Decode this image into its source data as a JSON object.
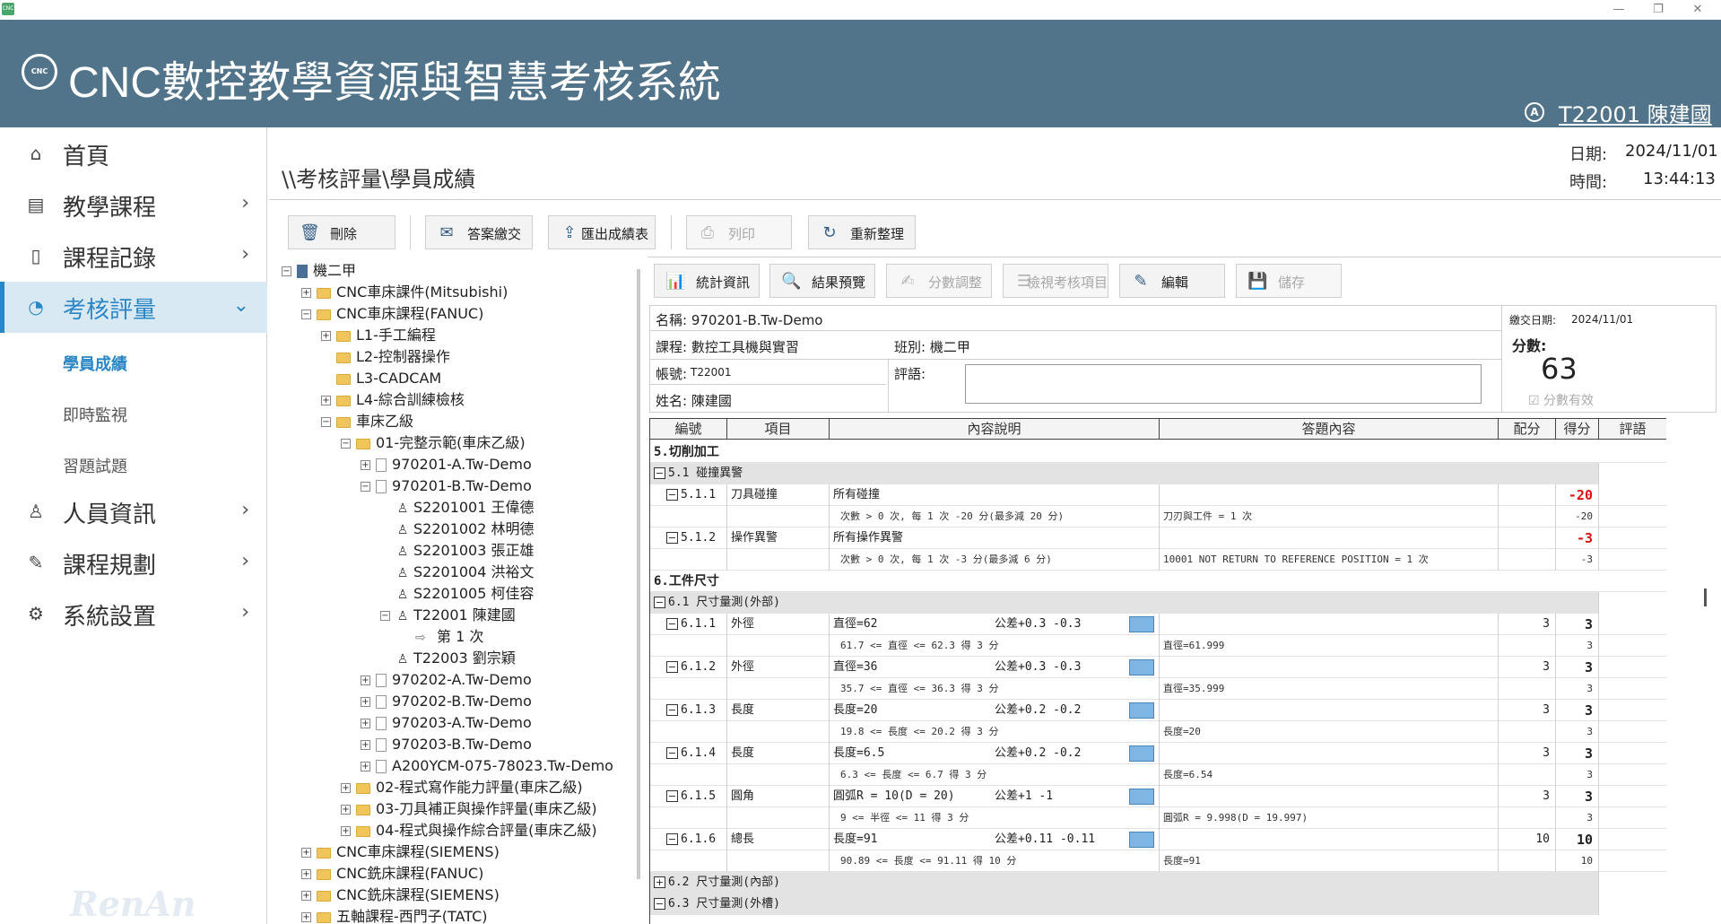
{
  "window": {
    "icon_text": "CNC",
    "minimize": "—",
    "maximize": "❐",
    "close": "✕"
  },
  "header": {
    "logo_text": "CNC",
    "title": "CNC數控教學資源與智慧考核系統",
    "user_icon": "A",
    "user": "T22001 陳建國"
  },
  "sidebar": {
    "items": [
      {
        "label": "首頁",
        "icon": "home-icon"
      },
      {
        "label": "教學課程",
        "icon": "cnc-icon"
      },
      {
        "label": "課程記錄",
        "icon": "document-icon"
      },
      {
        "label": "考核評量",
        "icon": "chart-icon"
      },
      {
        "label": "人員資訊",
        "icon": "person-icon"
      },
      {
        "label": "課程規劃",
        "icon": "pencil-icon"
      },
      {
        "label": "系統設置",
        "icon": "gear-icon"
      }
    ],
    "sub_items": [
      "學員成績",
      "即時監視",
      "習題試題"
    ],
    "watermark": "RenAn"
  },
  "content": {
    "breadcrumb": "\\\\考核評量\\學員成績",
    "date_label": "日期:",
    "date_value": "2024/11/01",
    "time_label": "時間:",
    "time_value": "13:44:13"
  },
  "toolbar1": [
    "刪除",
    "答案繳交",
    "匯出成績表",
    "列印",
    "重新整理"
  ],
  "toolbar2": [
    "統計資訊",
    "結果預覽",
    "分數調整",
    "檢視考核項目",
    "編輯",
    "儲存"
  ],
  "tree": [
    {
      "text": "機二甲",
      "kind": "root",
      "exp": "−"
    },
    {
      "text": "CNC車床課件(Mitsubishi)",
      "kind": "folder",
      "exp": "+"
    },
    {
      "text": "CNC車床課程(FANUC)",
      "kind": "folder",
      "exp": "−"
    },
    {
      "text": "L1-手工編程",
      "kind": "folder",
      "exp": "+"
    },
    {
      "text": "L2-控制器操作",
      "kind": "folder",
      "exp": ""
    },
    {
      "text": "L3-CADCAM",
      "kind": "folder",
      "exp": ""
    },
    {
      "text": "L4-綜合訓練檢核",
      "kind": "folder",
      "exp": "+"
    },
    {
      "text": "車床乙級",
      "kind": "folder",
      "exp": "−"
    },
    {
      "text": "01-完整示範(車床乙級)",
      "kind": "folder",
      "exp": "−"
    },
    {
      "text": "970201-A.Tw-Demo",
      "kind": "doc",
      "exp": "+"
    },
    {
      "text": "970201-B.Tw-Demo",
      "kind": "doc",
      "exp": "−"
    },
    {
      "text": "S2201001 王偉德",
      "kind": "person",
      "exp": ""
    },
    {
      "text": "S2201002 林明德",
      "kind": "person",
      "exp": ""
    },
    {
      "text": "S2201003 張正雄",
      "kind": "person",
      "exp": ""
    },
    {
      "text": "S2201004 洪裕文",
      "kind": "person",
      "exp": ""
    },
    {
      "text": "S2201005 柯佳容",
      "kind": "person",
      "exp": ""
    },
    {
      "text": "T22001 陳建國",
      "kind": "person",
      "exp": "−"
    },
    {
      "text": "第 1 次",
      "kind": "arrow",
      "exp": ""
    },
    {
      "text": "T22003 劉宗穎",
      "kind": "person",
      "exp": ""
    },
    {
      "text": "970202-A.Tw-Demo",
      "kind": "doc",
      "exp": "+"
    },
    {
      "text": "970202-B.Tw-Demo",
      "kind": "doc",
      "exp": "+"
    },
    {
      "text": "970203-A.Tw-Demo",
      "kind": "doc",
      "exp": "+"
    },
    {
      "text": "970203-B.Tw-Demo",
      "kind": "doc",
      "exp": "+"
    },
    {
      "text": "A200YCM-075-78023.Tw-Demo",
      "kind": "doc",
      "exp": "+"
    },
    {
      "text": "02-程式寫作能力評量(車床乙級)",
      "kind": "folder",
      "exp": "+"
    },
    {
      "text": "03-刀具補正與操作評量(車床乙級)",
      "kind": "folder",
      "exp": "+"
    },
    {
      "text": "04-程式與操作綜合評量(車床乙級)",
      "kind": "folder",
      "exp": "+"
    },
    {
      "text": "CNC車床課程(SIEMENS)",
      "kind": "folder",
      "exp": "+"
    },
    {
      "text": "CNC銑床課程(FANUC)",
      "kind": "folder",
      "exp": "+"
    },
    {
      "text": "CNC銑床課程(SIEMENS)",
      "kind": "folder",
      "exp": "+"
    },
    {
      "text": "五軸課程-西門子(TATC)",
      "kind": "folder",
      "exp": "+"
    }
  ],
  "info": {
    "name": "名稱: 970201-B.Tw-Demo",
    "submit_date_label": "繳交日期:",
    "submit_date": "2024/11/01",
    "course": "課程: 數控工具機與實習",
    "class": "班別: 機二甲",
    "account_label": "帳號:",
    "account": "T22001",
    "comment_label": "評語:",
    "student": "姓名: 陳建國",
    "score_label": "分數:",
    "score": "63",
    "score_valid": "☑ 分數有效"
  },
  "grid": {
    "headers": [
      "編號",
      "項目",
      "內容說明",
      "答題內容",
      "配分",
      "得分",
      "評語"
    ],
    "rows": [
      {
        "type": "sec",
        "text": "5.切削加工"
      },
      {
        "type": "subsec",
        "mk": "−",
        "text": "5.1 碰撞異警"
      },
      {
        "type": "item",
        "mk": "−",
        "no": "5.1.1",
        "item": "刀具碰撞",
        "desc": "所有碰撞",
        "tol": "",
        "ans": "",
        "pts": "",
        "got": "-20",
        "red": true
      },
      {
        "type": "sub",
        "desc": "次數 > 0 次, 每 1 次 -20 分(最多減 20 分)",
        "ans": "刀刃與工件 = 1 次",
        "got": "-20"
      },
      {
        "type": "item",
        "mk": "−",
        "no": "5.1.2",
        "item": "操作異警",
        "desc": "所有操作異警",
        "tol": "",
        "ans": "",
        "pts": "",
        "got": "-3",
        "red": true
      },
      {
        "type": "sub",
        "desc": "次數 > 0 次, 每 1 次 -3 分(最多減 6 分)",
        "ans": "10001 NOT RETURN TO REFERENCE POSITION = 1 次",
        "got": "-3"
      },
      {
        "type": "sec",
        "text": "6.工件尺寸"
      },
      {
        "type": "subsec",
        "mk": "−",
        "text": "6.1 尺寸量測(外部)"
      },
      {
        "type": "item",
        "mk": "−",
        "no": "6.1.1",
        "item": "外徑",
        "desc": "直徑=62",
        "tol": "公差+0.3    -0.3",
        "ans": "",
        "pts": "3",
        "got": "3",
        "icon": true
      },
      {
        "type": "sub",
        "desc": "61.7 <= 直徑 <= 62.3 得 3 分",
        "ans": "直徑=61.999",
        "got": "3"
      },
      {
        "type": "item",
        "mk": "−",
        "no": "6.1.2",
        "item": "外徑",
        "desc": "直徑=36",
        "tol": "公差+0.3    -0.3",
        "ans": "",
        "pts": "3",
        "got": "3",
        "icon": true
      },
      {
        "type": "sub",
        "desc": "35.7 <= 直徑 <= 36.3 得 3 分",
        "ans": "直徑=35.999",
        "got": "3"
      },
      {
        "type": "item",
        "mk": "−",
        "no": "6.1.3",
        "item": "長度",
        "desc": "長度=20",
        "tol": "公差+0.2    -0.2",
        "ans": "",
        "pts": "3",
        "got": "3",
        "icon": true
      },
      {
        "type": "sub",
        "desc": "19.8 <= 長度 <= 20.2 得 3 分",
        "ans": "長度=20",
        "got": "3"
      },
      {
        "type": "item",
        "mk": "−",
        "no": "6.1.4",
        "item": "長度",
        "desc": "長度=6.5",
        "tol": "公差+0.2    -0.2",
        "ans": "",
        "pts": "3",
        "got": "3",
        "icon": true
      },
      {
        "type": "sub",
        "desc": "6.3 <= 長度 <= 6.7 得 3 分",
        "ans": "長度=6.54",
        "got": "3"
      },
      {
        "type": "item",
        "mk": "−",
        "no": "6.1.5",
        "item": "圓角",
        "desc": "圓弧R = 10(D = 20)",
        "tol": "公差+1      -1",
        "ans": "",
        "pts": "3",
        "got": "3",
        "icon": true
      },
      {
        "type": "sub",
        "desc": "9 <= 半徑 <= 11 得 3 分",
        "ans": "圓弧R = 9.998(D = 19.997)",
        "got": "3"
      },
      {
        "type": "item",
        "mk": "−",
        "no": "6.1.6",
        "item": "總長",
        "desc": "長度=91",
        "tol": "公差+0.11   -0.11",
        "ans": "",
        "pts": "10",
        "got": "10",
        "icon": true
      },
      {
        "type": "sub",
        "desc": "90.89 <= 長度 <= 91.11 得 10 分",
        "ans": "長度=91",
        "got": "10"
      },
      {
        "type": "subsec",
        "mk": "+",
        "text": "6.2 尺寸量測(內部)"
      },
      {
        "type": "subsec",
        "mk": "−",
        "text": "6.3 尺寸量測(外槽)"
      }
    ]
  }
}
